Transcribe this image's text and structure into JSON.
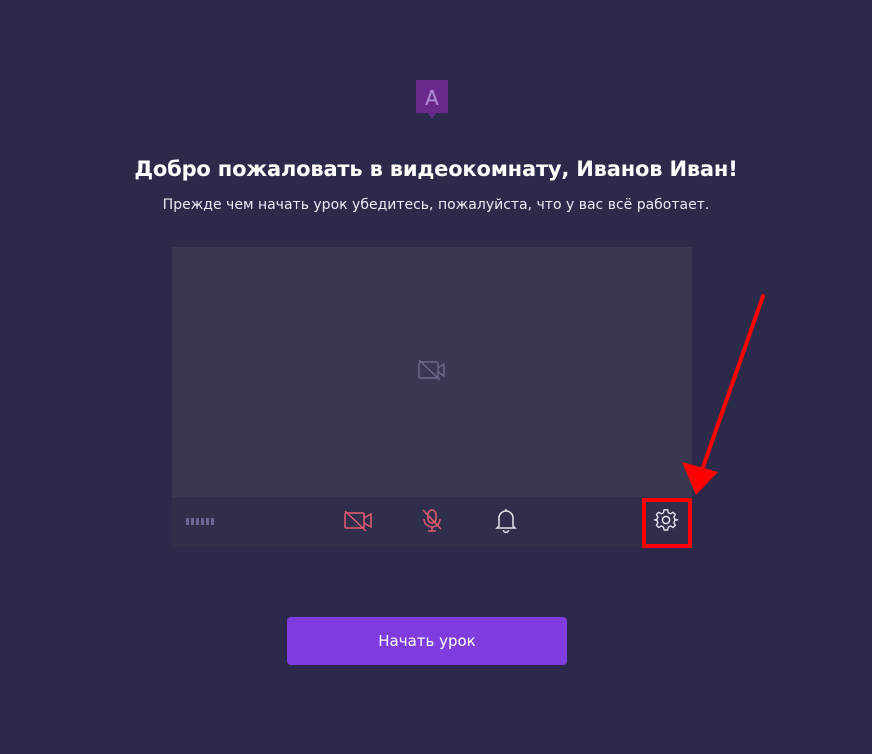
{
  "header": {
    "logo_letter": "A",
    "title": "Добро пожаловать в видеокомнату, Иванов Иван!",
    "subtitle": "Прежде чем начать урок убедитесь, пожалуйста, что у вас всё работает."
  },
  "video_preview": {
    "camera_state": "off",
    "placeholder_icon": "camera-off-icon"
  },
  "toolbar": {
    "mic_level_icon": "mic-level-indicator",
    "buttons": [
      {
        "name": "camera-toggle",
        "icon": "camera-off-icon",
        "color": "#e55b6f"
      },
      {
        "name": "microphone-toggle",
        "icon": "mic-off-icon",
        "color": "#e55b6f"
      },
      {
        "name": "notification-sound",
        "icon": "bell-icon",
        "color": "#e4e3ee"
      },
      {
        "name": "settings",
        "icon": "gear-icon",
        "color": "#e4e3ee"
      }
    ]
  },
  "actions": {
    "start_lesson_label": "Начать урок"
  },
  "colors": {
    "background": "#2b2a4b",
    "panel": "#393853",
    "toolbar": "#2f2e4b",
    "accent": "#7f3de0",
    "muted_red": "#e55b6f",
    "annotation": "#ff0000",
    "logo": "#6a2a8c"
  }
}
